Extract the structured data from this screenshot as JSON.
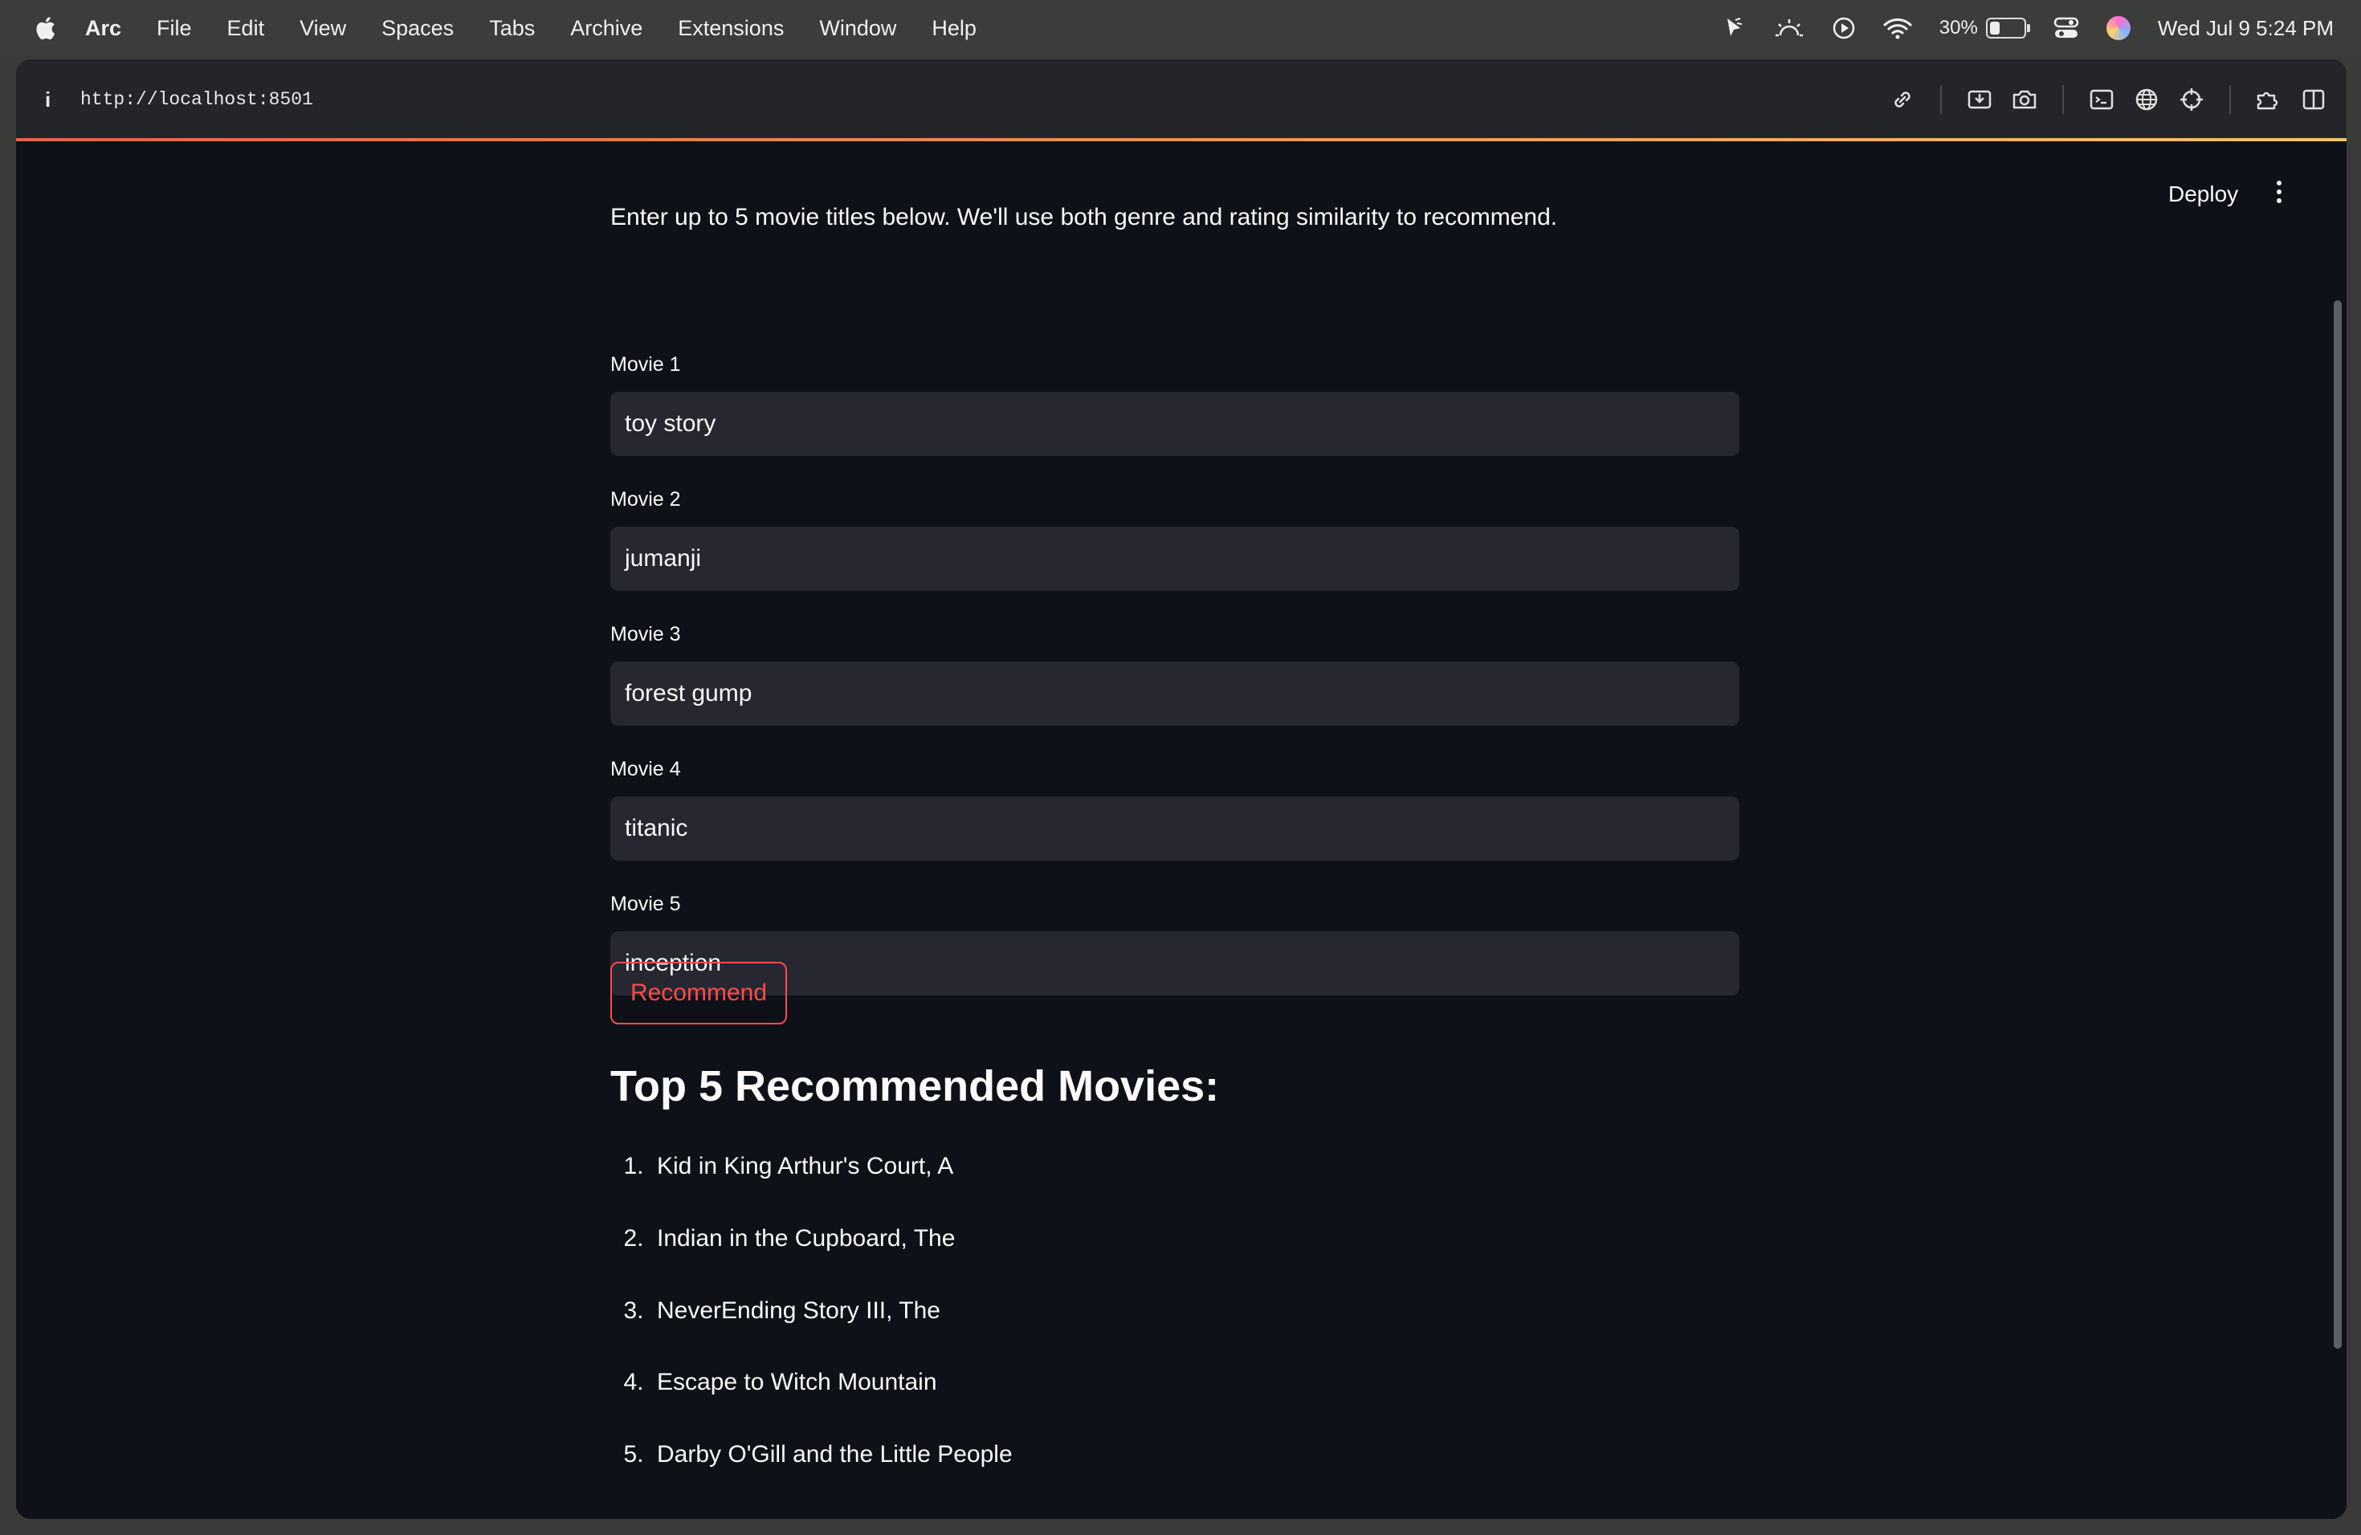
{
  "menubar": {
    "app_name": "Arc",
    "menus": [
      "File",
      "Edit",
      "View",
      "Spaces",
      "Tabs",
      "Archive",
      "Extensions",
      "Window",
      "Help"
    ],
    "battery_percent": "30%",
    "battery_level": 0.3,
    "datetime": "Wed Jul 9  5:24 PM"
  },
  "browser": {
    "url": "http://localhost:8501",
    "progress_gradient": [
      "#e4604f",
      "#f0c46a"
    ]
  },
  "app": {
    "deploy_label": "Deploy",
    "intro": "Enter up to 5 movie titles below. We'll use both genre and rating similarity to recommend.",
    "fields": [
      {
        "label": "Movie 1",
        "value": "toy story"
      },
      {
        "label": "Movie 2",
        "value": "jumanji"
      },
      {
        "label": "Movie 3",
        "value": "forest gump"
      },
      {
        "label": "Movie 4",
        "value": "titanic"
      },
      {
        "label": "Movie 5",
        "value": "inception"
      }
    ],
    "button_label": "Recommend",
    "results_heading": "Top 5 Recommended Movies:",
    "results": [
      {
        "num": "1.",
        "title": "Kid in King Arthur's Court, A"
      },
      {
        "num": "2.",
        "title": "Indian in the Cupboard, The"
      },
      {
        "num": "3.",
        "title": "NeverEnding Story III, The"
      },
      {
        "num": "4.",
        "title": "Escape to Witch Mountain"
      },
      {
        "num": "5.",
        "title": "Darby O'Gill and the Little People"
      }
    ]
  },
  "colors": {
    "app_bg": "#0e1117",
    "input_bg": "#262730",
    "accent": "#ff4b4b",
    "text": "#fafafa"
  }
}
